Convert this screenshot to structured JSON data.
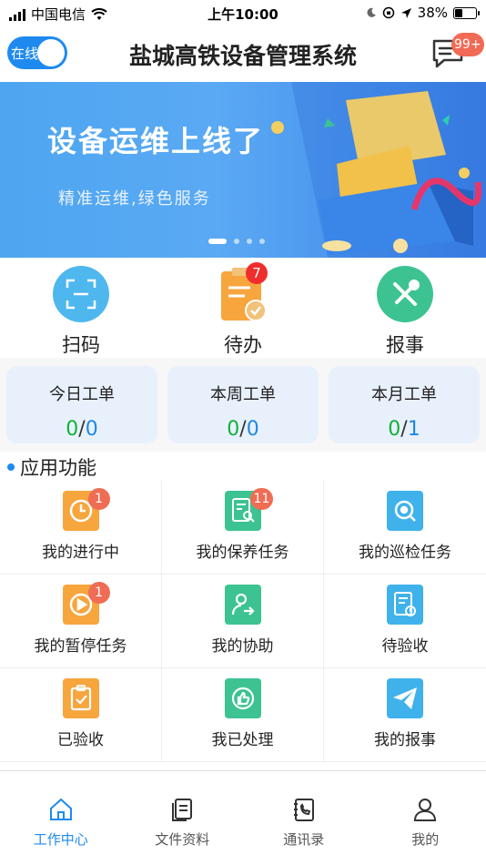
{
  "status_bar": {
    "carrier": "中国电信",
    "time": "上午10:00",
    "battery": "38%"
  },
  "header": {
    "toggle_label": "在线",
    "title": "盐城高铁设备管理系统",
    "message_badge": "99+"
  },
  "banner": {
    "headline": "设备运维上线了",
    "subline": "精准运维,绿色服务",
    "slide_count": 4,
    "active_slide": 1
  },
  "quick_actions": [
    {
      "label": "扫码",
      "icon": "scan-icon",
      "color": "#4eb7ee"
    },
    {
      "label": "待办",
      "icon": "todo-clipboard-icon",
      "color": "#f7a53d",
      "badge": "7"
    },
    {
      "label": "报事",
      "icon": "tools-icon",
      "color": "#3cc391"
    }
  ],
  "work_orders": [
    {
      "title": "今日工单",
      "done": "0",
      "sep": "/",
      "total": "0"
    },
    {
      "title": "本周工单",
      "done": "0",
      "sep": "/",
      "total": "0"
    },
    {
      "title": "本月工单",
      "done": "0",
      "sep": "/",
      "total": "1"
    }
  ],
  "section_title": "应用功能",
  "apps": [
    {
      "label": "我的进行中",
      "icon": "clock-icon",
      "color": "#f7a53d",
      "badge": "1"
    },
    {
      "label": "我的保养任务",
      "icon": "maintenance-doc-icon",
      "color": "#3cc391",
      "badge": "11"
    },
    {
      "label": "我的巡检任务",
      "icon": "eye-icon",
      "color": "#3fb2ec",
      "badge": ""
    },
    {
      "label": "我的暂停任务",
      "icon": "pause-play-icon",
      "color": "#f7a53d",
      "badge": "1"
    },
    {
      "label": "我的协助",
      "icon": "assist-user-icon",
      "color": "#3cc391",
      "badge": ""
    },
    {
      "label": "待验收",
      "icon": "pending-check-doc-icon",
      "color": "#3fb2ec",
      "badge": ""
    },
    {
      "label": "已验收",
      "icon": "checked-clipboard-icon",
      "color": "#f7a53d",
      "badge": ""
    },
    {
      "label": "我已处理",
      "icon": "thumbs-up-icon",
      "color": "#3cc391",
      "badge": ""
    },
    {
      "label": "我的报事",
      "icon": "paper-plane-icon",
      "color": "#3fb2ec",
      "badge": ""
    }
  ],
  "tabbar": [
    {
      "label": "工作中心",
      "icon": "home-icon",
      "active": true
    },
    {
      "label": "文件资料",
      "icon": "files-icon",
      "active": false
    },
    {
      "label": "通讯录",
      "icon": "contacts-icon",
      "active": false
    },
    {
      "label": "我的",
      "icon": "user-icon",
      "active": false
    }
  ]
}
